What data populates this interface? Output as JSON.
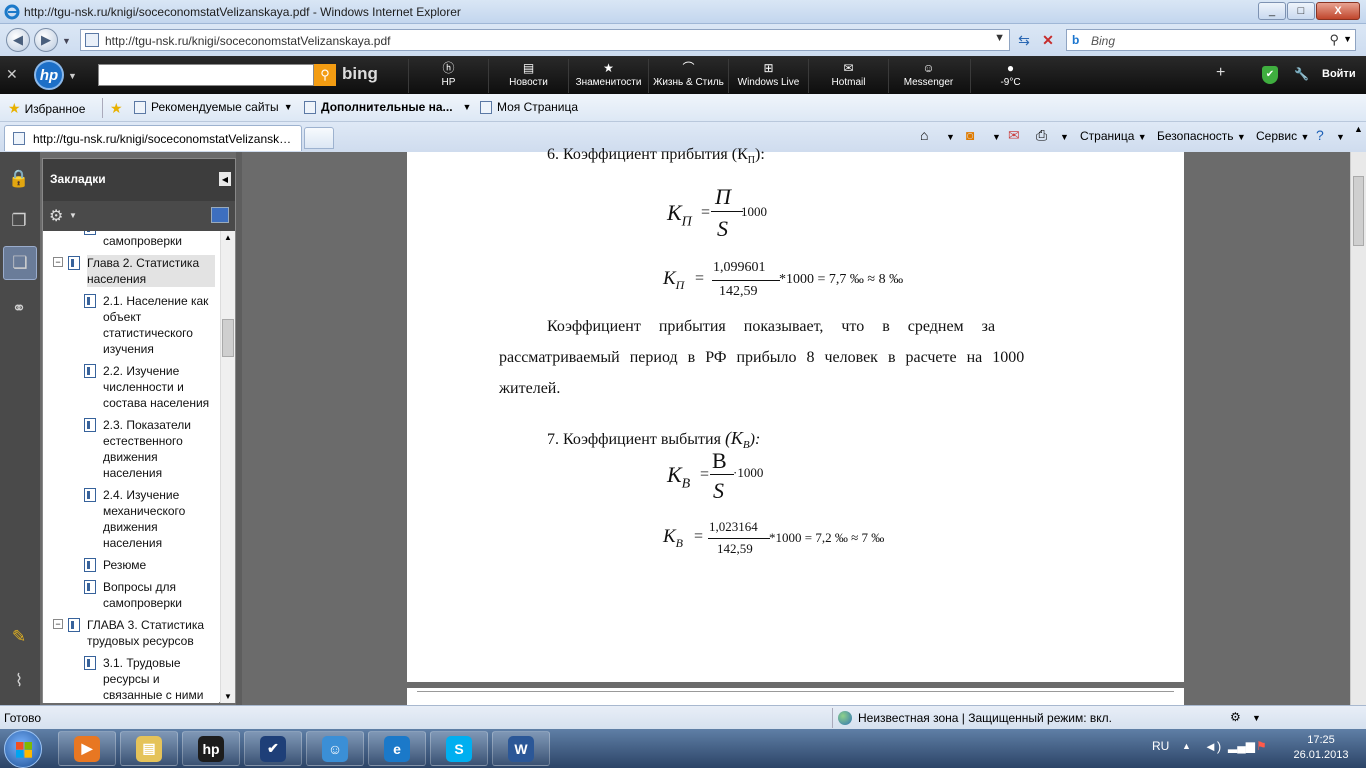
{
  "window": {
    "title": "http://tgu-nsk.ru/knigi/soceconomstatVelizanskaya.pdf - Windows Internet Explorer",
    "minimize": "_",
    "maximize": "□",
    "close": "X"
  },
  "address_bar": {
    "url": "http://tgu-nsk.ru/knigi/soceconomstatVelizanskaya.pdf",
    "search_placeholder": "Bing"
  },
  "hp_toolbar": {
    "bing_word": "bing",
    "items": [
      {
        "label": "HP",
        "icon": "hp-icon"
      },
      {
        "label": "Новости",
        "icon": "news-icon"
      },
      {
        "label": "Знаменитости",
        "icon": "star-icon"
      },
      {
        "label": "Жизнь & Стиль",
        "icon": "shoe-icon"
      },
      {
        "label": "Windows Live",
        "icon": "windows-icon"
      },
      {
        "label": "Hotmail",
        "icon": "mail-icon"
      },
      {
        "label": "Messenger",
        "icon": "messenger-icon"
      },
      {
        "label": "-9°C",
        "icon": "weather-icon"
      }
    ],
    "login": "Войти"
  },
  "favorites_bar": {
    "favorites": "Избранное",
    "items": [
      "Рекомендуемые сайты",
      "Дополнительные на...",
      "Моя Страница"
    ]
  },
  "tabs": [
    {
      "title": "http://tgu-nsk.ru/knigi/soceconomstatVelizanskaya.pdf"
    }
  ],
  "command_bar": {
    "page": "Страница",
    "safety": "Безопасность",
    "tools": "Сервис"
  },
  "bookmarks": {
    "title": "Закладки",
    "items": [
      {
        "label": "самопроверки",
        "level": 2
      },
      {
        "label": "Глава 2. Статистика населения",
        "level": 1,
        "expanded": true,
        "selected": true
      },
      {
        "label": "2.1. Население как объект статистического изучения",
        "level": 2
      },
      {
        "label": "2.2. Изучение численности и состава населения",
        "level": 2
      },
      {
        "label": "2.3. Показатели естественного движения населения",
        "level": 2
      },
      {
        "label": "2.4. Изучение механического движения населения",
        "level": 2
      },
      {
        "label": "Резюме",
        "level": 2
      },
      {
        "label": "Вопросы для самопроверки",
        "level": 2
      },
      {
        "label": "ГЛАВА 3. Статистика трудовых ресурсов",
        "level": 1,
        "expanded": true
      },
      {
        "label": "3.1. Трудовые ресурсы и связанные с ними",
        "level": 2
      }
    ]
  },
  "document": {
    "heading6": "6. Коэффициент прибытия (К",
    "heading6_sub": "П",
    "heading6_end": "):",
    "f1_lhs": "К",
    "f1_lhs_sub": "П",
    "f1_eq": "=",
    "f1_num": "П",
    "f1_den": "S",
    "f1_mult": "1000",
    "f2_lhs": "К",
    "f2_lhs_sub": "П",
    "f2_eq": "=",
    "f2_num": "1,099601",
    "f2_den": "142,59",
    "f2_rest": "*1000 = 7,7  ‰ ≈ 8 ‰",
    "para_line1": "Коэффициент прибытия    показывает, что в среднем за",
    "para_line2": "рассматриваемый период в РФ прибыло 8 человек в расчете на 1000",
    "para_line3": "жителей.",
    "heading7": "7. Коэффициент выбытия",
    "heading7_k": "(К",
    "heading7_sub": "В",
    "heading7_end": "):",
    "f3_lhs": "К",
    "f3_lhs_sub": "В",
    "f3_eq": "=",
    "f3_num": "В",
    "f3_den": "S",
    "f3_mult": "·1000",
    "f4_lhs": "К",
    "f4_lhs_sub": "В",
    "f4_eq": "=",
    "f4_num": "1,023164",
    "f4_den": "142,59",
    "f4_rest": "*1000 = 7,2  ‰ ≈ 7 ‰"
  },
  "status_bar": {
    "ready": "Готово",
    "zone": "Неизвестная зона | Защищенный режим: вкл."
  },
  "taskbar": {
    "lang": "RU",
    "time": "17:25",
    "date": "26.01.2013",
    "apps": [
      {
        "name": "media-player",
        "color": "#e87722",
        "glyph": "▶"
      },
      {
        "name": "explorer-folder",
        "color": "#e5c35a",
        "glyph": "▤"
      },
      {
        "name": "hp",
        "color": "#1d1d1d",
        "glyph": "hp"
      },
      {
        "name": "hp-checkmark",
        "color": "#1e3f78",
        "glyph": "✔"
      },
      {
        "name": "messenger",
        "color": "#3b8fd6",
        "glyph": "☺"
      },
      {
        "name": "internet-explorer",
        "color": "#1b79c9",
        "glyph": "e"
      },
      {
        "name": "skype",
        "color": "#00aff0",
        "glyph": "S"
      },
      {
        "name": "word",
        "color": "#2b5797",
        "glyph": "W"
      }
    ]
  }
}
